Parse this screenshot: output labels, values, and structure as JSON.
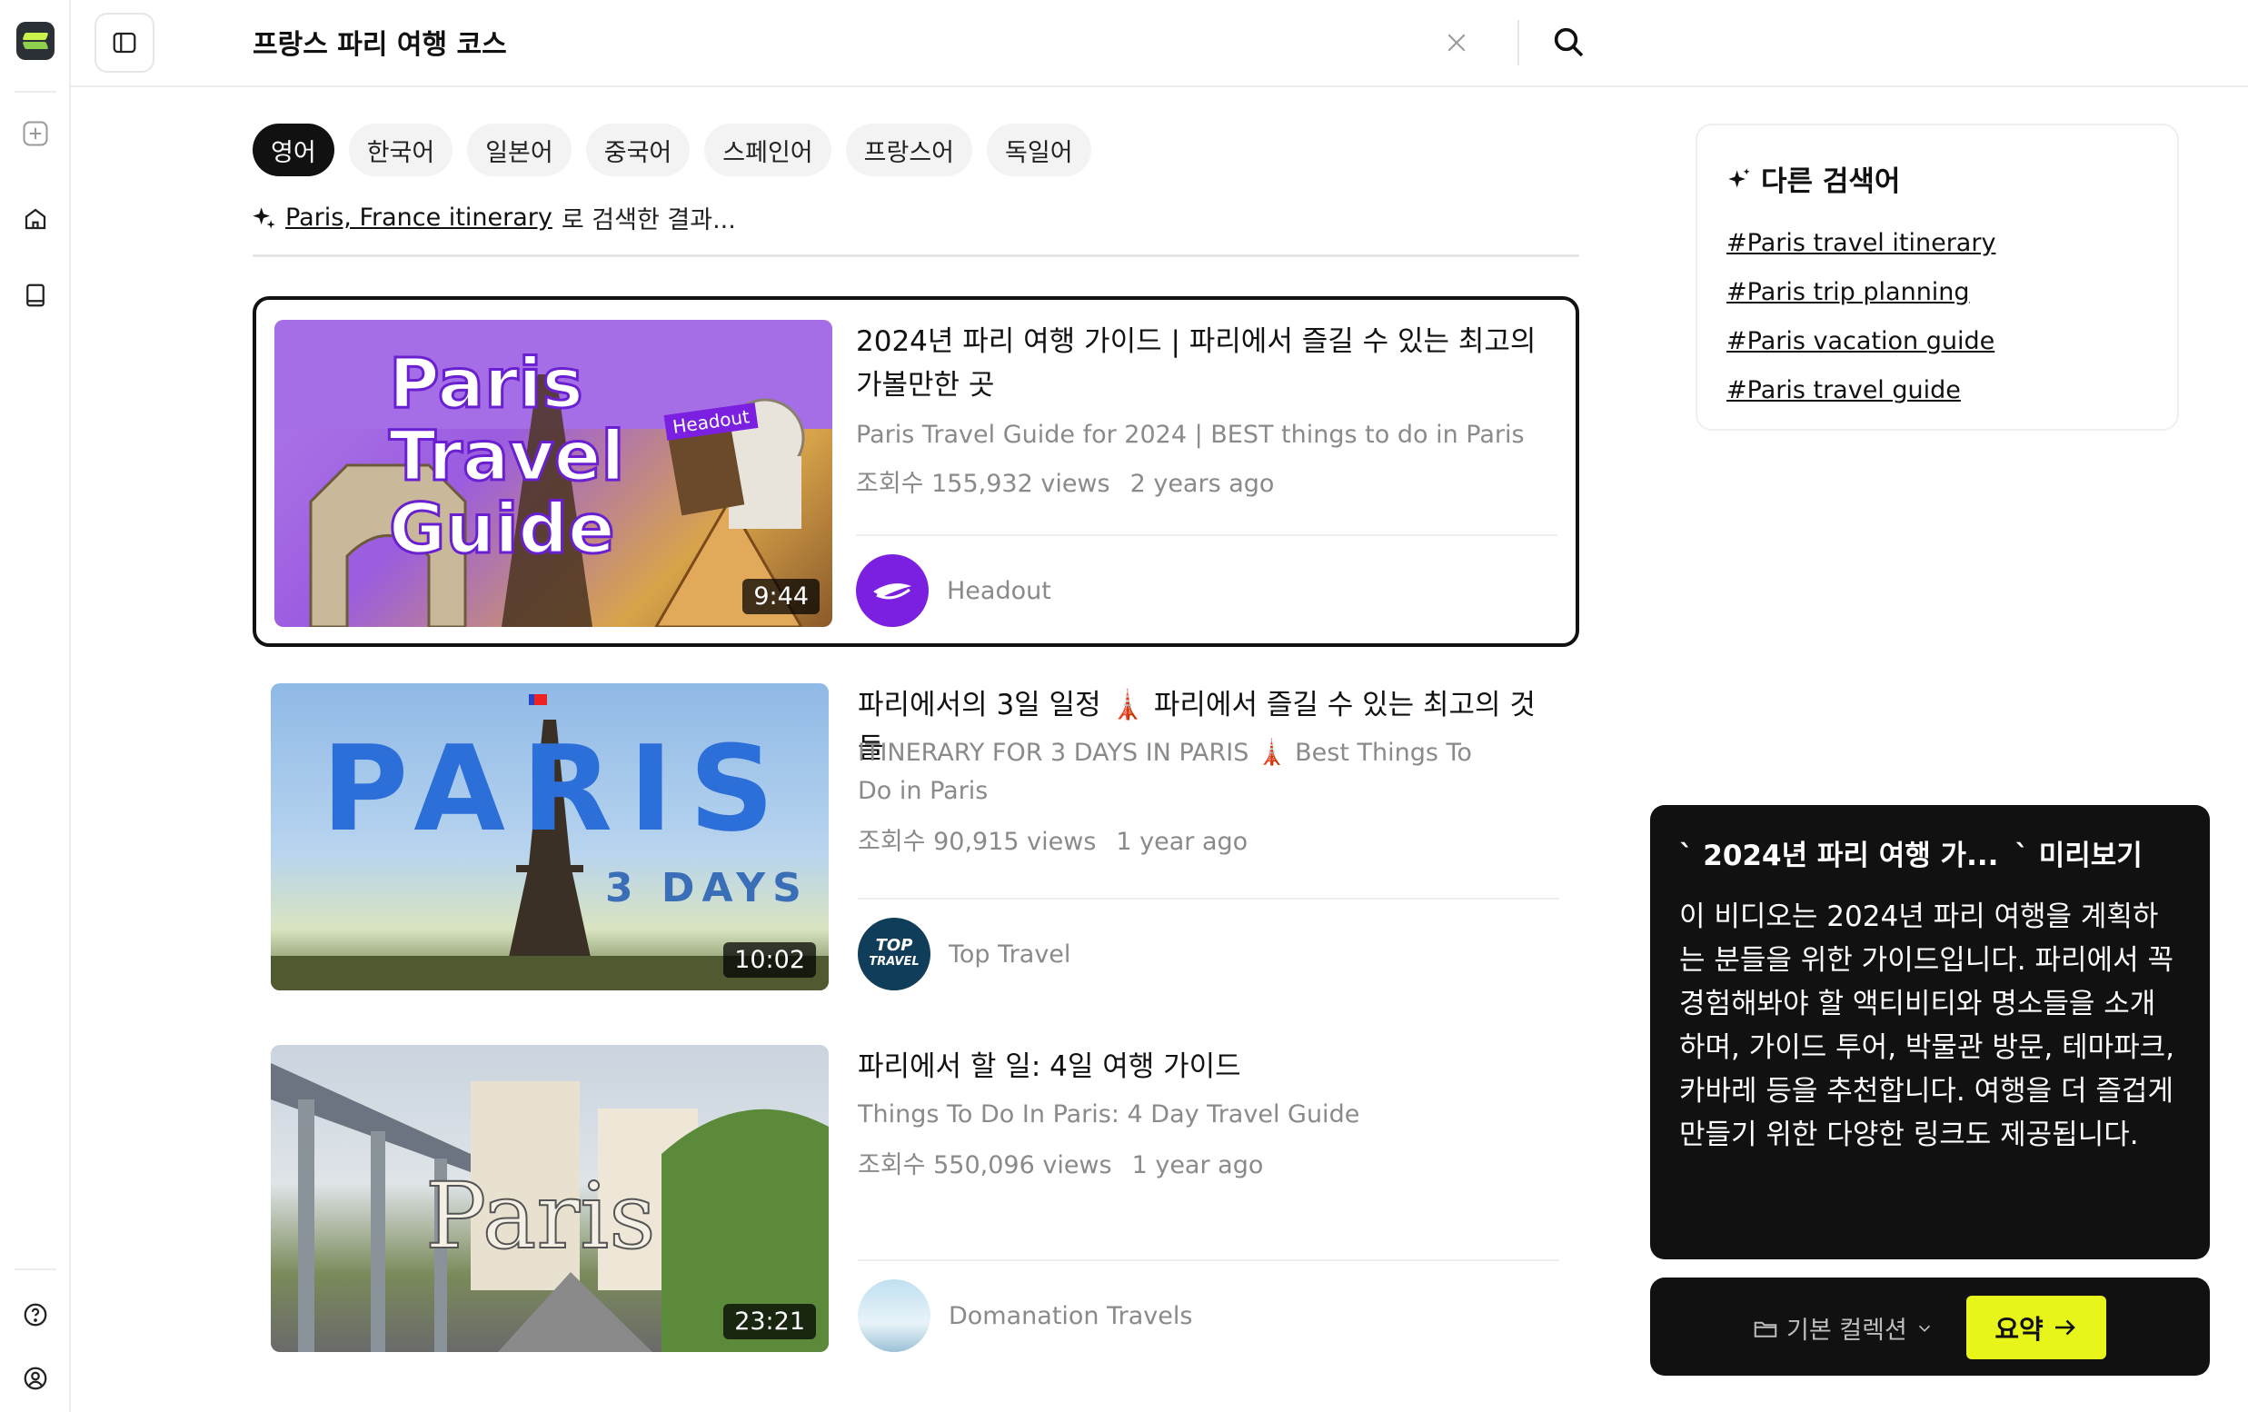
{
  "topbar": {
    "query": "프랑스 파리 여행 코스"
  },
  "languages": [
    "영어",
    "한국어",
    "일본어",
    "중국어",
    "스페인어",
    "프랑스어",
    "독일어"
  ],
  "search_note": {
    "keyword": "Paris, France itinerary",
    "suffix": "로 검색한 결과..."
  },
  "videos": [
    {
      "title": "2024년 파리 여행 가이드 | 파리에서 즐길 수 있는 최고의 가볼만한 곳",
      "subtitle": "Paris Travel Guide for 2024 | BEST things to do in Paris",
      "views": "조회수 155,932 views",
      "age": "2 years ago",
      "duration": "9:44",
      "channel": "Headout",
      "thumb_text": [
        "Paris",
        "Travel",
        "Guide"
      ],
      "thumb_tag": "Headout"
    },
    {
      "title": "파리에서의 3일 일정 🗼 파리에서 즐길 수 있는 최고의 것들",
      "subtitle": "ITINERARY FOR 3 DAYS IN PARIS 🗼 Best Things To Do in Paris",
      "views": "조회수 90,915 views",
      "age": "1 year ago",
      "duration": "10:02",
      "channel": "Top Travel",
      "thumb_text": [
        "PARIS",
        "3 DAYS"
      ],
      "avatar_text": [
        "TOP",
        "TRAVEL"
      ]
    },
    {
      "title": "파리에서 할 일: 4일 여행 가이드",
      "subtitle": "Things To Do In Paris: 4 Day Travel Guide",
      "views": "조회수 550,096 views",
      "age": "1 year ago",
      "duration": "23:21",
      "channel": "Domanation Travels",
      "thumb_text": [
        "Paris"
      ]
    }
  ],
  "related": {
    "title": "다른 검색어",
    "tags": [
      "#Paris travel itinerary",
      "#Paris trip planning",
      "#Paris vacation guide",
      "#Paris travel guide"
    ]
  },
  "preview": {
    "title_part1": "` 2024년 파리 여행 가...",
    "title_part2": "` 미리보기",
    "body": "이 비디오는 2024년 파리 여행을 계획하는 분들을 위한 가이드입니다. 파리에서 꼭 경험해봐야 할 액티비티와 명소들을 소개하며, 가이드 투어, 박물관 방문, 테마파크, 카바레 등을 추천합니다. 여행을 더 즐겁게 만들기 위한 다양한 링크도 제공됩니다."
  },
  "actions": {
    "collection": "기본 컬렉션",
    "summary": "요약"
  },
  "colors": {
    "accent": "#e8f51a",
    "headout": "#7b1fe0",
    "selected_border": "#111111"
  }
}
